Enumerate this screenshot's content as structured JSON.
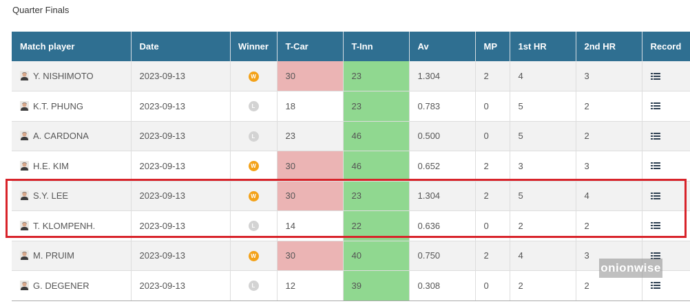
{
  "section_title": "Quarter Finals",
  "columns": {
    "player": "Match player",
    "date": "Date",
    "winner": "Winner",
    "tcar": "T-Car",
    "tinn": "T-Inn",
    "av": "Av",
    "mp": "MP",
    "hr1": "1st HR",
    "hr2": "2nd HR",
    "record": "Record"
  },
  "badge_labels": {
    "win": "W",
    "loss": "L"
  },
  "rows": [
    {
      "player": "Y. NISHIMOTO",
      "date": "2023-09-13",
      "result": "win",
      "tcar": "30",
      "tinn": "23",
      "av": "1.304",
      "mp": "2",
      "hr1": "4",
      "hr2": "3"
    },
    {
      "player": "K.T. PHUNG",
      "date": "2023-09-13",
      "result": "loss",
      "tcar": "18",
      "tinn": "23",
      "av": "0.783",
      "mp": "0",
      "hr1": "5",
      "hr2": "2"
    },
    {
      "player": "A. CARDONA",
      "date": "2023-09-13",
      "result": "loss",
      "tcar": "23",
      "tinn": "46",
      "av": "0.500",
      "mp": "0",
      "hr1": "5",
      "hr2": "2"
    },
    {
      "player": "H.E. KIM",
      "date": "2023-09-13",
      "result": "win",
      "tcar": "30",
      "tinn": "46",
      "av": "0.652",
      "mp": "2",
      "hr1": "3",
      "hr2": "3"
    },
    {
      "player": "S.Y. LEE",
      "date": "2023-09-13",
      "result": "win",
      "tcar": "30",
      "tinn": "23",
      "av": "1.304",
      "mp": "2",
      "hr1": "5",
      "hr2": "4"
    },
    {
      "player": "T. KLOMPENH.",
      "date": "2023-09-13",
      "result": "loss",
      "tcar": "14",
      "tinn": "22",
      "av": "0.636",
      "mp": "0",
      "hr1": "2",
      "hr2": "2"
    },
    {
      "player": "M. PRUIM",
      "date": "2023-09-13",
      "result": "win",
      "tcar": "30",
      "tinn": "40",
      "av": "0.750",
      "mp": "2",
      "hr1": "4",
      "hr2": "3"
    },
    {
      "player": "G. DEGENER",
      "date": "2023-09-13",
      "result": "loss",
      "tcar": "12",
      "tinn": "39",
      "av": "0.308",
      "mp": "0",
      "hr1": "2",
      "hr2": "2"
    }
  ],
  "icons": {
    "avatar": "player-avatar-icon",
    "record": "list-icon"
  },
  "colors": {
    "header_bg": "#2f6f91",
    "win_badge": "#f3a21a",
    "loss_badge": "#d3d3d3",
    "tcar_highlight": "#ebb4b4",
    "tinn_highlight": "#90d890",
    "highlight_box": "#d8232a"
  },
  "watermark": "onionwise"
}
